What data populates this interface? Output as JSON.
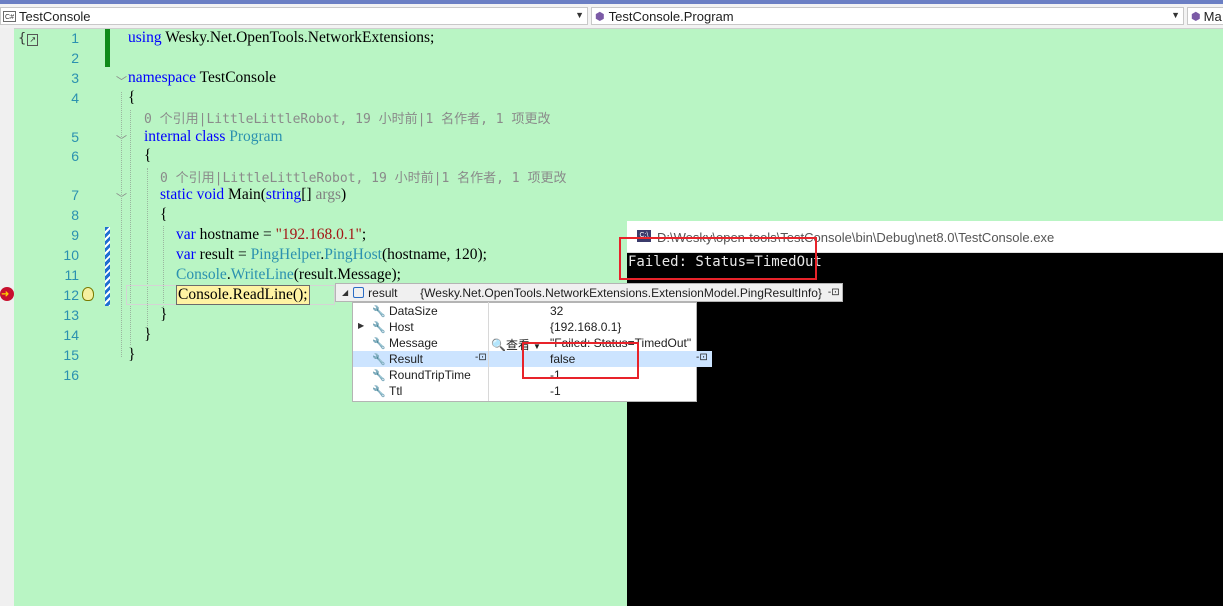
{
  "nav": {
    "project": "TestConsole",
    "class": "TestConsole.Program",
    "member": "Ma",
    "project_icon": "C#"
  },
  "lines": [
    "1",
    "2",
    "3",
    "4",
    "5",
    "6",
    "7",
    "8",
    "9",
    "10",
    "11",
    "12",
    "13",
    "14",
    "15",
    "16"
  ],
  "code": {
    "l1_kw": "using",
    "l1_rest": " Wesky.Net.OpenTools.NetworkExtensions;",
    "l3_kw": "namespace",
    "l3_rest": " TestConsole",
    "l4": "{",
    "lens1": "0 个引用|LittleLittleRobot, 19 小时前|1 名作者, 1 项更改",
    "l5_kw": "internal class",
    "l5_ty": " Program",
    "l6": "{",
    "lens2": "0 个引用|LittleLittleRobot, 19 小时前|1 名作者, 1 项更改",
    "l7_kw": "static void",
    "l7_main": " Main(",
    "l7_kw2": "string",
    "l7_brk": "[] ",
    "l7_par": "args",
    "l7_end": ")",
    "l8": "{",
    "l9_kw": "var",
    "l9_mid": " hostname = ",
    "l9_str": "\"192.168.0.1\"",
    "l9_end": ";",
    "l10_kw": "var",
    "l10_mid": " result = ",
    "l10_ty": "PingHelper",
    "l10_dot": ".",
    "l10_m": "PingHost",
    "l10_end": "(hostname, 120);",
    "l11_ty": "Console",
    "l11_dot": ".",
    "l11_m": "WriteLine",
    "l11_end": "(result.Message);",
    "l12": "Console.ReadLine();",
    "l13": "}",
    "l14": "}",
    "l15": "}"
  },
  "console": {
    "icon": "C:\\",
    "title": "D:\\Wesky\\open-tools\\TestConsole\\bin\\Debug\\net8.0\\TestConsole.exe",
    "output": "Failed: Status=TimedOut"
  },
  "datatip": {
    "name": "result",
    "type": "{Wesky.Net.OpenTools.NetworkExtensions.ExtensionModel.PingResultInfo}",
    "rows": [
      {
        "name": "DataSize",
        "value": "32"
      },
      {
        "name": "Host",
        "value": "{192.168.0.1}"
      },
      {
        "name": "Message",
        "value": "\"Failed: Status=TimedOut\"",
        "viewer": "查看"
      },
      {
        "name": "Result",
        "value": "false"
      },
      {
        "name": "RoundTripTime",
        "value": "-1"
      },
      {
        "name": "Ttl",
        "value": "-1"
      }
    ]
  },
  "colors": {
    "editor_bg": "#b9f5c4",
    "keyword": "#0000ff",
    "type": "#2b91af",
    "string": "#a31515",
    "highlight": "#e8232a"
  }
}
